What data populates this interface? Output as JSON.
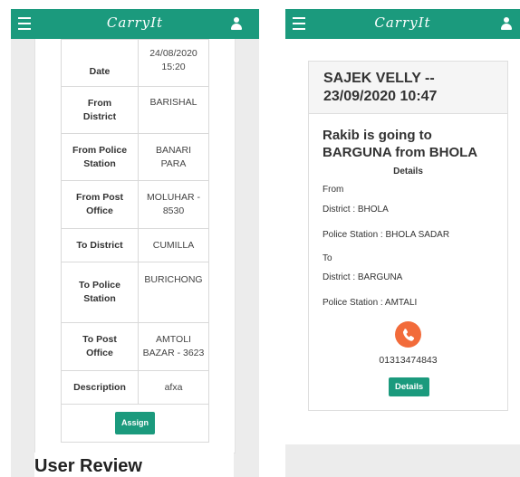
{
  "app": {
    "brand": "CarryIt"
  },
  "left": {
    "rows": [
      {
        "label": "Date",
        "value": "24/08/2020\n15:20"
      },
      {
        "label": "From\nDistrict",
        "value": "BARISHAL"
      },
      {
        "label": "From Police\nStation",
        "value": "BANARI\nPARA"
      },
      {
        "label": "From Post\nOffice",
        "value": "MOLUHAR -\n8530"
      },
      {
        "label": "To District",
        "value": "CUMILLA"
      },
      {
        "label": "To Police\nStation",
        "value": "BURICHONG"
      },
      {
        "label": "To Post\nOffice",
        "value": "AMTOLI\nBAZAR - 3623"
      },
      {
        "label": "Description",
        "value": "afxa"
      }
    ],
    "assign_label": "Assign",
    "review_title": "User Review"
  },
  "right": {
    "card_title": "SAJEK VELLY --\n23/09/2020 10:47",
    "headline": "Rakib is going to\nBARGUNA from BHOLA",
    "details_heading": "Details",
    "from_label": "From",
    "from_district": "District : BHOLA",
    "from_police": "Police Station : BHOLA SADAR",
    "to_label": "To",
    "to_district": "District : BARGUNA",
    "to_police": "Police Station : AMTALI",
    "phone": "01313474843",
    "details_button": "Details"
  },
  "colors": {
    "nav": "#1b9a7d",
    "button": "#1b9a7d",
    "call": "#f26b3a"
  }
}
